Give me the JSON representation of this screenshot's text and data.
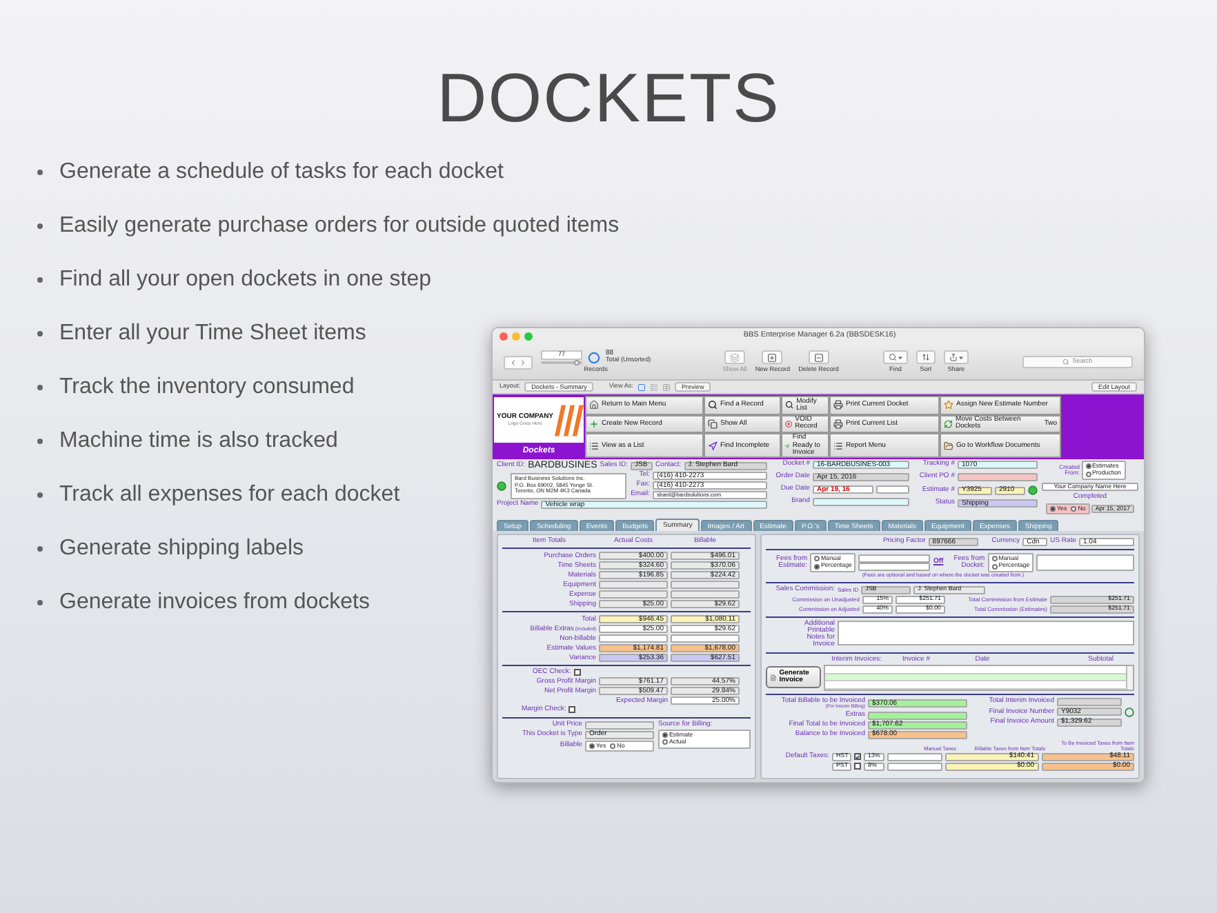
{
  "slide": {
    "title": "DOCKETS",
    "bullets": [
      "Generate a schedule of tasks for each docket",
      "Easily generate purchase orders for outside quoted items",
      "Find all your open dockets in one step",
      "Enter all your Time Sheet items",
      "Track the inventory consumed",
      "Machine time is also tracked",
      "Track all expenses for each docket",
      "Generate shipping labels",
      "Generate invoices from dockets"
    ]
  },
  "window": {
    "title": "BBS Enterprise Manager 6.2a (BBSDESK16)",
    "toolbar": {
      "record_number": "77",
      "record_slider": {
        "level": 0.87
      },
      "total": "88",
      "total_label": "Total (Unsorted)",
      "records_label": "Records",
      "buttons": [
        {
          "label": "Show All",
          "disabled": true
        },
        {
          "label": "New Record",
          "disabled": false
        },
        {
          "label": "Delete Record",
          "disabled": false
        }
      ],
      "tools": [
        {
          "label": "Find"
        },
        {
          "label": "Sort"
        },
        {
          "label": "Share"
        }
      ],
      "search_placeholder": "Search"
    },
    "layout_bar": {
      "layout_label": "Layout:",
      "layout": "Dockets - Summary",
      "view_as_label": "View As:",
      "views": [
        {
          "kind": "form",
          "selected": true
        },
        {
          "kind": "list",
          "selected": false
        },
        {
          "kind": "table",
          "selected": false
        }
      ],
      "preview": "Preview",
      "edit_layout": "Edit Layout"
    },
    "header": {
      "logo_text": "YOUR COMPANY",
      "logo_sub": "Logo Goes Here",
      "section": "Dockets",
      "buttons": [
        [
          {
            "label": "Return to Main Menu"
          },
          {
            "label": "Create New Record"
          },
          {
            "label": "View as a List"
          }
        ],
        [
          {
            "label": "Find a Record"
          },
          {
            "label": "Show All"
          },
          {
            "label": "Find Incomplete"
          }
        ],
        [
          {
            "label": "Modify List"
          },
          {
            "label": "VOID Record"
          },
          {
            "label": "Find Ready to Invoice"
          }
        ],
        [
          {
            "label": "Print Current Docket"
          },
          {
            "label": "Print Current List"
          },
          {
            "label": "Report Menu"
          }
        ],
        [
          {
            "label": "Assign New Estimate Number"
          },
          {
            "label": "Move Costs Between Dockets",
            "extra": "Two"
          },
          {
            "label": "Go to Workflow Documents"
          }
        ]
      ]
    },
    "client": {
      "client_id_label": "Client ID:",
      "client_id": "BARDBUSINES",
      "sales_id_label": "Sales ID:",
      "sales_id": "JSB",
      "contact_label": "Contact:",
      "contact": "J. Stephen Bard",
      "address": [
        "Bard Business Solutions Inc.",
        "P.O. Box 69002, 5845 Yonge St.",
        "Toronto, ON  M2M 4K3  Canada"
      ],
      "phones": [
        {
          "label": "Tel:",
          "value": "(416) 410-2273"
        },
        {
          "label": "Fax:",
          "value": "(416) 410-2273"
        },
        {
          "label": "Email:",
          "value": "sbard@bardsolutions.com"
        }
      ],
      "project_label": "Project Name",
      "project": "Vehicle wrap"
    },
    "docket": [
      {
        "label": "Docket #",
        "value": "16-BARDBUSINES-003"
      },
      {
        "label": "Order Date",
        "value": "Apr 15, 2016"
      },
      {
        "label": "Due Date",
        "value": "Apr 19, 16"
      },
      {
        "label": "Brand"
      }
    ],
    "tracking": [
      {
        "label": "Tracking #",
        "value": "1070"
      },
      {
        "label": "Client PO #"
      },
      {
        "label": "Estimate #",
        "value": "Y3925",
        "extra": "2910"
      },
      {
        "label": "Status",
        "value": "Shipping"
      }
    ],
    "created": {
      "label": "Created From:",
      "options": [
        {
          "label": "Estimates",
          "selected": true
        },
        {
          "label": "Production",
          "selected": false
        }
      ],
      "company": "Your Company Name Here",
      "completed_label": "Completed",
      "completed_options": [
        {
          "label": "Yes",
          "selected": true
        },
        {
          "label": "No",
          "selected": false
        }
      ],
      "completed_date": "Apr 15, 2017"
    },
    "tabs": [
      {
        "label": "Setup",
        "selected": false
      },
      {
        "label": "Scheduling",
        "selected": false
      },
      {
        "label": "Events",
        "selected": false
      },
      {
        "label": "Budgets",
        "selected": false
      },
      {
        "label": "Summary",
        "selected": true
      },
      {
        "label": "Images / Art",
        "selected": false
      },
      {
        "label": "Estimate",
        "selected": false
      },
      {
        "label": "P.O.'s",
        "selected": false
      },
      {
        "label": "Time Sheets",
        "selected": false
      },
      {
        "label": "Materials",
        "selected": false
      },
      {
        "label": "Equipment",
        "selected": false
      },
      {
        "label": "Expenses",
        "selected": false
      },
      {
        "label": "Shipping",
        "selected": false
      }
    ],
    "totals": {
      "columns": [
        "Item Totals",
        "Actual Costs",
        "Billable"
      ],
      "cost_rows": [
        {
          "label": "Purchase Orders",
          "actual": "$400.00",
          "billable": "$496.01"
        },
        {
          "label": "Time Sheets",
          "actual": "$324.60",
          "billable": "$370.06"
        },
        {
          "label": "Materials",
          "actual": "$196.85",
          "billable": "$224.42"
        },
        {
          "label": "Equipment"
        },
        {
          "label": "Expense"
        },
        {
          "label": "Shipping",
          "actual": "$25.00",
          "billable": "$29.62"
        }
      ],
      "summary_rows": [
        {
          "label": "Total",
          "actual": "$946.45",
          "billable": "$1,080.11"
        },
        {
          "label": "Billable Extras",
          "note": "(Included)",
          "actual": "$25.00",
          "billable": "$29.62"
        },
        {
          "label": "Non-billable"
        },
        {
          "label": "Estimate Values",
          "actual": "$1,174.81",
          "billable": "$1,678.00"
        },
        {
          "label": "Variance",
          "actual": "$253.36",
          "billable": "$627.51"
        }
      ]
    },
    "margins": {
      "oec_label": "OEC Check:",
      "oec_checked": false,
      "rows": [
        {
          "label": "Gross Profit Margin",
          "amount": "$761.17",
          "percent": "44.57%"
        },
        {
          "label": "Net Profit Margin",
          "amount": "$509.47",
          "percent": "29.84%"
        }
      ],
      "expected_label": "Expected Margin",
      "expected": "25.00%",
      "margin_check_label": "Margin Check:",
      "margin_checked": false
    },
    "billing": {
      "unit_price_label": "Unit Price",
      "type_label": "This Docket is Type",
      "type": "Order",
      "billable_label": "Billable",
      "billable_options": [
        {
          "label": "Yes",
          "selected": true
        },
        {
          "label": "No",
          "selected": false
        }
      ],
      "source_label": "Source for Billing:",
      "source_options": [
        {
          "label": "Estimate",
          "selected": true
        },
        {
          "label": "Actual",
          "selected": false
        }
      ]
    },
    "pricing": {
      "pricing_factor_label": "Pricing Factor",
      "pricing_factor": "897666",
      "currency_label": "Currency",
      "currency": "Cdn",
      "us_rate_label": "US Rate",
      "us_rate": "1.04"
    },
    "fees": {
      "estimate_label": "Fees from Estimate:",
      "estimate_options": [
        {
          "label": "Manual",
          "selected": false
        },
        {
          "label": "Percentage",
          "selected": true
        }
      ],
      "off_link": "Off",
      "docket_label": "Fees from Docket:",
      "docket_options": [
        {
          "label": "Manual",
          "selected": false
        },
        {
          "label": "Percentage",
          "selected": false
        }
      ],
      "note": "(Fees are optional and based on where the docket was created from.)"
    },
    "commission": {
      "label": "Sales Commission:",
      "sales_id_label": "Sales ID",
      "sales_id": "JSB",
      "rep": "J. Stephen Bard",
      "rows": [
        {
          "label": "Commission on Unadjusted",
          "rate": "15%",
          "amount": "$251.71",
          "total_label": "Total Commission from Estimate",
          "total": "$251.71"
        },
        {
          "label": "Commission on Adjusted",
          "rate": "40%",
          "amount": "$0.00",
          "total_label": "Total Commission (Estimates)",
          "total": "$251.71"
        }
      ]
    },
    "notes_label": "Additional Printable Notes for Invoice",
    "interim": {
      "label": "Interim Invoices:",
      "columns": [
        "Invoice #",
        "Date",
        "Subtotal"
      ],
      "generate": "Generate Invoice"
    },
    "invoice_left": [
      {
        "label": "Total Billable to be Invoiced",
        "note": "(For Interim Billing)",
        "value": "$370.06"
      },
      {
        "label": "Extras"
      },
      {
        "label": "Final Total to be Invoiced",
        "value": "$1,707.62"
      },
      {
        "label": "Balance to be Invoiced",
        "value": "$678.00"
      }
    ],
    "invoice_right": [
      {
        "label": "Total Interim Invoiced"
      },
      {
        "label": "Final Invoice Number",
        "value": "Y9032"
      },
      {
        "label": "Final Invoice Amount",
        "value": "$1,329.62"
      }
    ],
    "taxes": {
      "label": "Default Taxes:",
      "columns": [
        "Manual Taxes",
        "Billable Taxes from Item Totals",
        "To Be Invoiced Taxes from Item Totals"
      ],
      "rows": [
        {
          "name": "HST",
          "checked": true,
          "rate": "13%",
          "billable": "$140.41",
          "invoiced": "$48.11"
        },
        {
          "name": "PST",
          "checked": false,
          "rate": "8%",
          "billable": "$0.00",
          "invoiced": "$0.00"
        }
      ]
    }
  }
}
